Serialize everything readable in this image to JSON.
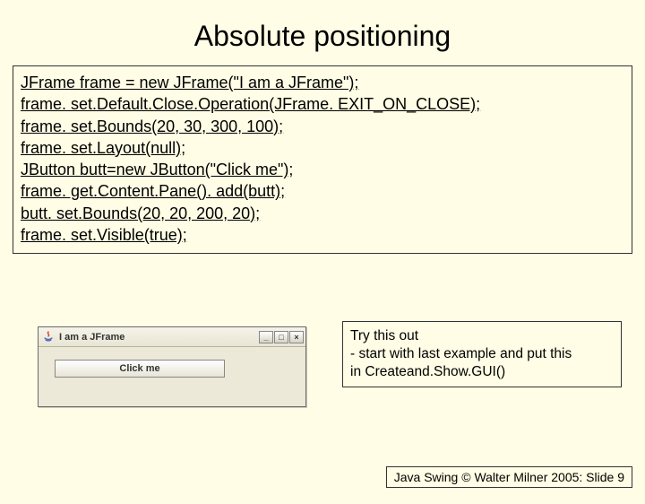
{
  "title": "Absolute positioning",
  "code": [
    "JFrame frame = new JFrame(\"I am a JFrame\");",
    "frame. set.Default.Close.Operation(JFrame. EXIT_ON_CLOSE);",
    "frame. set.Bounds(20, 30, 300, 100);",
    "frame. set.Layout(null);",
    "JButton butt=new JButton(\"Click me\");",
    "frame. get.Content.Pane(). add(butt);",
    "butt. set.Bounds(20, 20, 200, 20);",
    "frame. set.Visible(true);"
  ],
  "window": {
    "title": "I am a JFrame",
    "button_label": "Click me",
    "min": "_",
    "max": "□",
    "close": "×"
  },
  "note": {
    "line1": "Try this out",
    "line2": "- start with last example and put this",
    "line3": "in Createand.Show.GUI()"
  },
  "footer": "Java Swing © Walter Milner 2005: Slide 9"
}
